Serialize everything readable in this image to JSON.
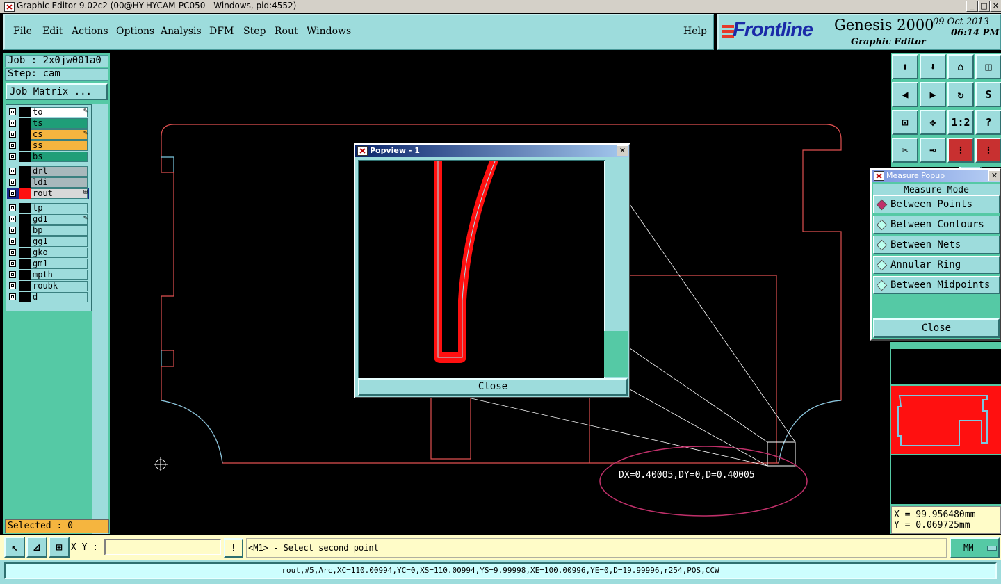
{
  "window": {
    "title": "Graphic Editor 9.02c2 (00@HY-HYCAM-PC050 - Windows, pid:4552)"
  },
  "menu": {
    "items": [
      "File",
      "Edit",
      "Actions",
      "Options",
      "Analysis",
      "DFM",
      "Step",
      "Rout",
      "Windows"
    ],
    "help": "Help"
  },
  "brand": {
    "logo": "Frontline",
    "product": "Genesis 2000",
    "subtitle": "Graphic Editor",
    "date": "09 Oct 2013",
    "time": "06:14 PM"
  },
  "job": {
    "job_label": "Job : 2x0jw001a0",
    "step_label": "Step: cam",
    "matrix_button": "Job Matrix ..."
  },
  "layers": {
    "group1": [
      {
        "name": "to",
        "bg": "#ffffff",
        "mark": "✎"
      },
      {
        "name": "ts",
        "bg": "#1f9e78",
        "mark": ""
      },
      {
        "name": "cs",
        "bg": "#f5b53f",
        "mark": "✎"
      },
      {
        "name": "ss",
        "bg": "#f5b53f",
        "mark": ""
      },
      {
        "name": "bs",
        "bg": "#1f9e78",
        "mark": ""
      }
    ],
    "group2": [
      {
        "name": "drl",
        "bg": "#a8b8bc",
        "mark": ""
      },
      {
        "name": "ldi",
        "bg": "#a8b8bc",
        "mark": ""
      },
      {
        "name": "rout",
        "bg": "#d8d8d8",
        "mark": "⊞"
      }
    ],
    "group3": [
      {
        "name": "tp",
        "bg": "#9ddcdc",
        "mark": ""
      },
      {
        "name": "gd1",
        "bg": "#9ddcdc",
        "mark": "✎"
      },
      {
        "name": "bp",
        "bg": "#9ddcdc",
        "mark": ""
      },
      {
        "name": "gg1",
        "bg": "#9ddcdc",
        "mark": ""
      },
      {
        "name": "gko",
        "bg": "#9ddcdc",
        "mark": ""
      },
      {
        "name": "gm1",
        "bg": "#9ddcdc",
        "mark": ""
      },
      {
        "name": "mpth",
        "bg": "#9ddcdc",
        "mark": ""
      },
      {
        "name": "roubk",
        "bg": "#9ddcdc",
        "mark": ""
      },
      {
        "name": "d",
        "bg": "#9ddcdc",
        "mark": ""
      }
    ]
  },
  "selected": "Selected : 0",
  "popview": {
    "title": "Popview - 1",
    "close": "Close"
  },
  "measure": {
    "title": "Measure Popup",
    "mode_label": "Measure Mode",
    "options": [
      "Between Points",
      "Between Contours",
      "Between Nets",
      "Annular Ring",
      "Between Midpoints"
    ],
    "selected_index": 0,
    "close": "Close"
  },
  "readout": {
    "measurement": "DX=0.40005,DY=0,D=0.40005",
    "x": "X = 99.956480mm",
    "y": "Y = 0.069725mm"
  },
  "toolbar_icons": [
    "1:2",
    "?"
  ],
  "bottom": {
    "xy_label": "X Y :",
    "xy_value": "",
    "prompt_button": "!",
    "prompt": "<M1> - Select second point",
    "units": "MM"
  },
  "status": "rout,#5,Arc,XC=110.00994,YC=0,XS=110.00994,YS=9.99998,XE=100.00996,YE=0,D=19.99996,r254,POS,CCW",
  "colors": {
    "panel": "#55c9a5",
    "button": "#9ddcdc",
    "highlight": "#c0306a",
    "outline": "#e05050",
    "red": "#ff1010"
  }
}
